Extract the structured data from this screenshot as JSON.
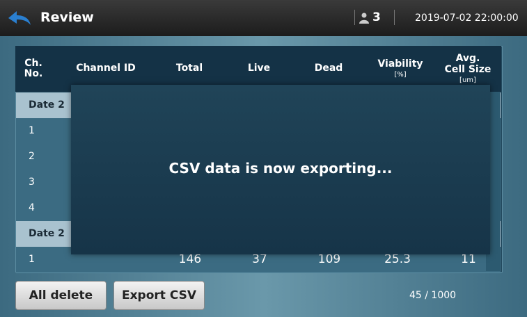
{
  "header": {
    "title": "Review",
    "user_count": "3",
    "datetime": "2019-07-02 22:00:00"
  },
  "table": {
    "columns": [
      {
        "label": "Ch.\nNo.",
        "unit": ""
      },
      {
        "label": "Channel ID",
        "unit": ""
      },
      {
        "label": "Total",
        "unit": ""
      },
      {
        "label": "Live",
        "unit": ""
      },
      {
        "label": "Dead",
        "unit": ""
      },
      {
        "label": "Viability",
        "unit": "[%]"
      },
      {
        "label": "Avg.\nCell Size",
        "unit": "[um]"
      }
    ],
    "groups": [
      {
        "label": "Date 2",
        "rows": [
          "1",
          "2",
          "3",
          "4"
        ]
      },
      {
        "label": "Date 2",
        "rows": [
          "1"
        ]
      }
    ],
    "last_row": {
      "ch": "1",
      "total": "146",
      "live": "37",
      "dead": "109",
      "viability": "25.3",
      "size": "11"
    }
  },
  "overlay": {
    "message": "CSV data is now exporting..."
  },
  "footer": {
    "all_delete": "All delete",
    "export_csv": "Export CSV",
    "page": "45 / 1000"
  },
  "colors": {
    "header": "#1c1c1c",
    "table_header": "#143246",
    "group_row": "#a9c2cf"
  }
}
